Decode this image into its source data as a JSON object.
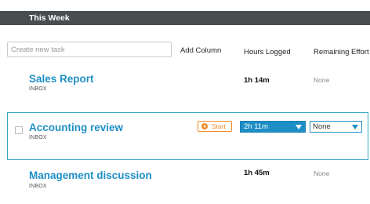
{
  "header": {
    "title": "This Week"
  },
  "toolbar": {
    "new_task_placeholder": "Create new task",
    "add_column_label": "Add Column"
  },
  "columns": {
    "hours_logged": "Hours Logged",
    "remaining_effort": "Remaining Effort"
  },
  "tasks": [
    {
      "title": "Sales Report",
      "list": "INBOX",
      "hours_logged": "1h 14m",
      "remaining_effort": "None"
    },
    {
      "title": "Accounting review",
      "list": "INBOX",
      "start_label": "Start",
      "hours_logged": "2h 11m",
      "remaining_effort": "None",
      "selected": true
    },
    {
      "title": "Management discussion",
      "list": "INBOX",
      "hours_logged": "1h 45m",
      "remaining_effort": "None"
    }
  ],
  "colors": {
    "header_bg": "#4a4d50",
    "title_blue": "#1e8fc6",
    "start_orange": "#f28c28",
    "selected_border": "#3aa4c6"
  },
  "icons": {
    "start": "play-circle-icon",
    "dropdown": "caret-down-icon"
  }
}
